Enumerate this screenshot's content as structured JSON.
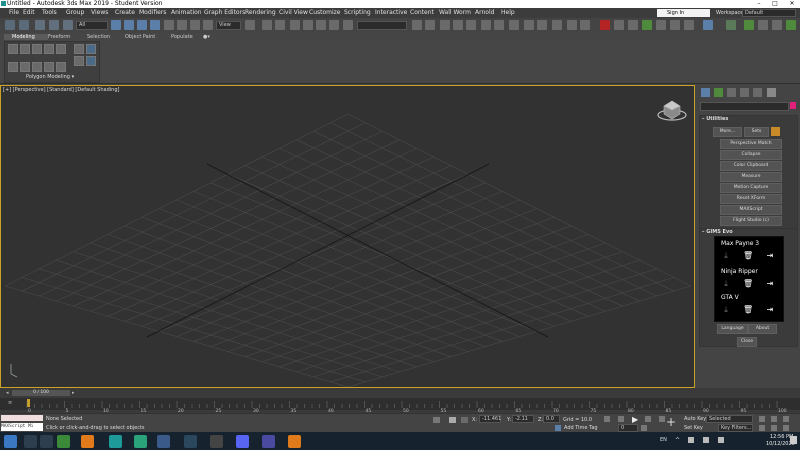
{
  "window": {
    "title": "Untitled - Autodesk 3ds Max 2019 - Student Version",
    "minimize": "–",
    "maximize": "□",
    "close": "✕"
  },
  "menu": [
    "File",
    "Edit",
    "Tools",
    "Group",
    "Views",
    "Create",
    "Modifiers",
    "Animation",
    "Graph Editors",
    "Rendering",
    "Civil View",
    "Customize",
    "Scripting",
    "Interactive",
    "Content",
    "Wall Worm",
    "Arnold",
    "Help"
  ],
  "signin": {
    "label": "Sign In"
  },
  "workspaces": {
    "label": "Workspaces:",
    "value": "Default"
  },
  "toolbar": {
    "filter_all": "All",
    "view_dropdown": "View"
  },
  "ribbon": {
    "tabs": [
      "Modeling",
      "Freeform",
      "Selection",
      "Object Paint",
      "Populate"
    ],
    "group_label": "Polygon Modeling"
  },
  "viewport": {
    "label": "[+] [Perspective] [Standard] [Default Shading]"
  },
  "command_panel": {
    "utilities_title": "Utilities",
    "more_button": "More...",
    "sets_button": "Sets",
    "utilities": [
      "Perspective Match",
      "Collapse",
      "Color Clipboard",
      "Measure",
      "Motion Capture",
      "Reset XForm",
      "MAXScript",
      "Flight Studio (c)"
    ],
    "gims_title": "GIMS Evo",
    "gims_games": [
      "Max Payne 3",
      "Ninja Ripper",
      "GTA V"
    ],
    "language_button": "Language",
    "about_button": "About",
    "close_button": "Close"
  },
  "timeline": {
    "frame": "0 / 100",
    "ticks": [
      "0",
      "5",
      "10",
      "15",
      "20",
      "25",
      "30",
      "35",
      "40",
      "45",
      "50",
      "55",
      "60",
      "65",
      "70",
      "75",
      "80",
      "85",
      "90",
      "95",
      "100"
    ]
  },
  "status": {
    "maxscript": "MAXScript Mi",
    "selection": "None Selected",
    "prompt": "Click or click-and-drag to select objects",
    "x_label": "X:",
    "x_value": "-11.461",
    "y_label": "Y:",
    "y_value": "-2.11",
    "z_label": "Z:",
    "z_value": "0.0",
    "grid": "Grid = 10.0",
    "add_time_tag": "Add Time Tag",
    "auto_key": "Auto Key",
    "set_key": "Set Key",
    "selected_dropdown": "Selected",
    "key_filters": "Key Filters...",
    "frame_value": "0"
  },
  "taskbar": {
    "lang": "EN",
    "time": "12:56 PM",
    "date": "10/12/2020"
  },
  "colors": {
    "viewport_border": "#c9a227",
    "accent_pink": "#e0207a",
    "taskbar": "#16232f"
  }
}
